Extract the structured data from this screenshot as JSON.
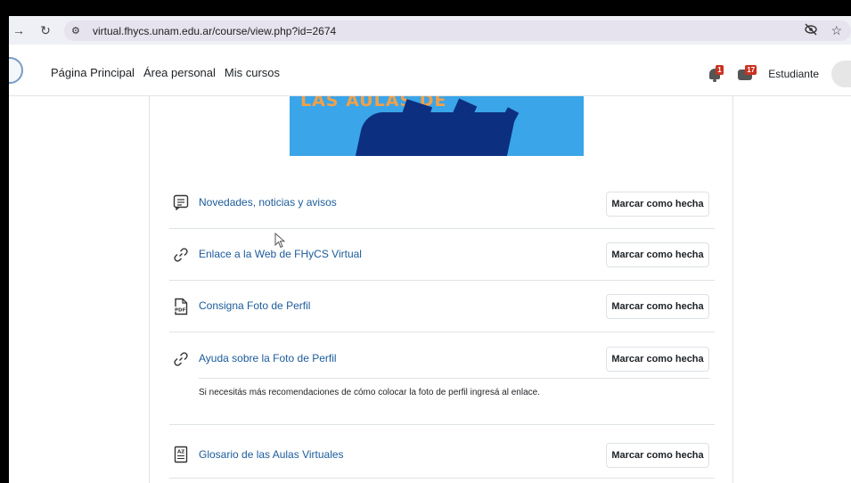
{
  "browser": {
    "url": "virtual.fhycs.unam.edu.ar/course/view.php?id=2674",
    "back_icon": "arrow-right-icon",
    "reload_icon": "reload-icon",
    "site_info_icon": "tune-icon",
    "eye_icon": "eye-off-icon",
    "star_icon": "star-icon"
  },
  "navbar": {
    "links": [
      "Página Principal",
      "Área personal",
      "Mis cursos"
    ],
    "notifications_count": "1",
    "messages_count": "17",
    "user_label": "Estudiante"
  },
  "banner": {
    "text": "LAS AULAS DE"
  },
  "activities": [
    {
      "title": "Novedades, noticias y avisos",
      "icon": "forum-icon",
      "button": "Marcar como hecha"
    },
    {
      "title": "Enlace a la Web de FHyCS Virtual",
      "icon": "link-icon",
      "button": "Marcar como hecha"
    },
    {
      "title": "Consigna Foto de Perfil",
      "icon": "pdf-icon",
      "button": "Marcar como hecha"
    },
    {
      "title": "Ayuda sobre la Foto de Perfil",
      "icon": "link-icon",
      "button": "Marcar como hecha",
      "description": "Si necesitás más recomendaciones de cómo colocar la foto de perfil ingresá al enlace."
    },
    {
      "title": "Glosario de las Aulas Virtuales",
      "icon": "glossary-icon",
      "button": "Marcar como hecha"
    }
  ],
  "colors": {
    "link": "#1b5b9a",
    "badge": "#ca3120",
    "banner_bg": "#3aa5e8",
    "banner_stroke": "#0c2f80"
  }
}
